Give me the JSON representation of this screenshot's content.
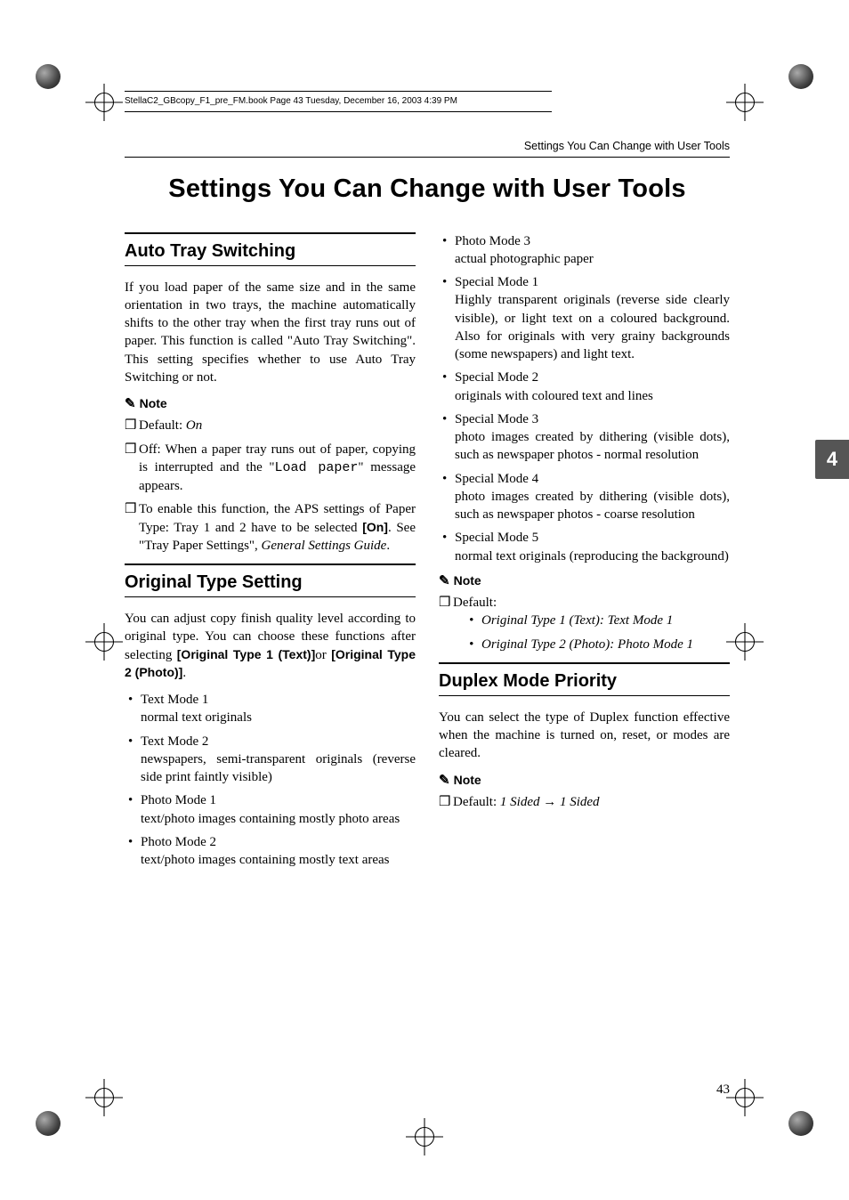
{
  "bookline": "StellaC2_GBcopy_F1_pre_FM.book  Page 43  Tuesday, December 16, 2003  4:39 PM",
  "running_head": "Settings You Can Change with User Tools",
  "page_title": "Settings You Can Change with User Tools",
  "thumb_tab": "4",
  "page_number": "43",
  "sec1": {
    "title": "Auto Tray Switching",
    "body": "If you load paper of the same size and in the same orientation in two trays, the machine automatically shifts to the other tray when the first tray runs out of paper. This function is called \"Auto Tray Switching\". This setting specifies whether to use Auto Tray Switching or not.",
    "note_label": "Note",
    "notes": {
      "n1_a": "Default: ",
      "n1_b": "On",
      "n2_a": "Off: When a paper tray runs out of paper, copying is interrupted and the \"",
      "n2_b": "Load paper",
      "n2_c": "\" message appears.",
      "n3_a": "To enable this function, the APS settings of Paper Type: Tray 1 and 2 have to be selected ",
      "n3_b": "[On]",
      "n3_c": ". See \"Tray Paper Settings\", ",
      "n3_d": "General Settings Guide",
      "n3_e": "."
    }
  },
  "sec2": {
    "title": "Original Type Setting",
    "body_a": "You can adjust copy finish quality level according to original type. You can choose these functions after selecting ",
    "body_b": "[Original Type 1 (Text)]",
    "body_c": "or ",
    "body_d": "[Original Type 2 (Photo)]",
    "body_e": ".",
    "modes": [
      {
        "name": "Text Mode 1",
        "desc": "normal text originals"
      },
      {
        "name": "Text Mode 2",
        "desc": "newspapers, semi-transparent originals (reverse side print faintly visible)"
      },
      {
        "name": "Photo Mode 1",
        "desc": "text/photo images containing mostly photo areas"
      },
      {
        "name": "Photo Mode 2",
        "desc": "text/photo images containing mostly text areas"
      },
      {
        "name": "Photo Mode 3",
        "desc": "actual photographic paper"
      },
      {
        "name": "Special Mode 1",
        "desc": "Highly transparent originals (reverse side clearly visible), or light text on a coloured background. Also for originals with very grainy backgrounds (some newspapers) and light text."
      },
      {
        "name": "Special Mode 2",
        "desc": "originals with coloured text and lines"
      },
      {
        "name": "Special Mode 3",
        "desc": "photo images created by dithering (visible dots), such as newspaper photos - normal resolution"
      },
      {
        "name": "Special Mode 4",
        "desc": "photo images created by dithering (visible dots), such as newspaper photos - coarse resolution"
      },
      {
        "name": "Special Mode 5",
        "desc": "normal text originals (reproducing the background)"
      }
    ],
    "note_label": "Note",
    "default_label": "Default:",
    "defaults": [
      "Original Type 1 (Text): Text Mode 1",
      "Original Type 2 (Photo): Photo Mode 1"
    ]
  },
  "sec3": {
    "title": "Duplex Mode Priority",
    "body": "You can select the type of Duplex function effective when the machine is turned on, reset, or modes are cleared.",
    "note_label": "Note",
    "default_a": "Default: ",
    "default_b": "1 Sided",
    "default_arrow": " → ",
    "default_c": "1 Sided"
  }
}
